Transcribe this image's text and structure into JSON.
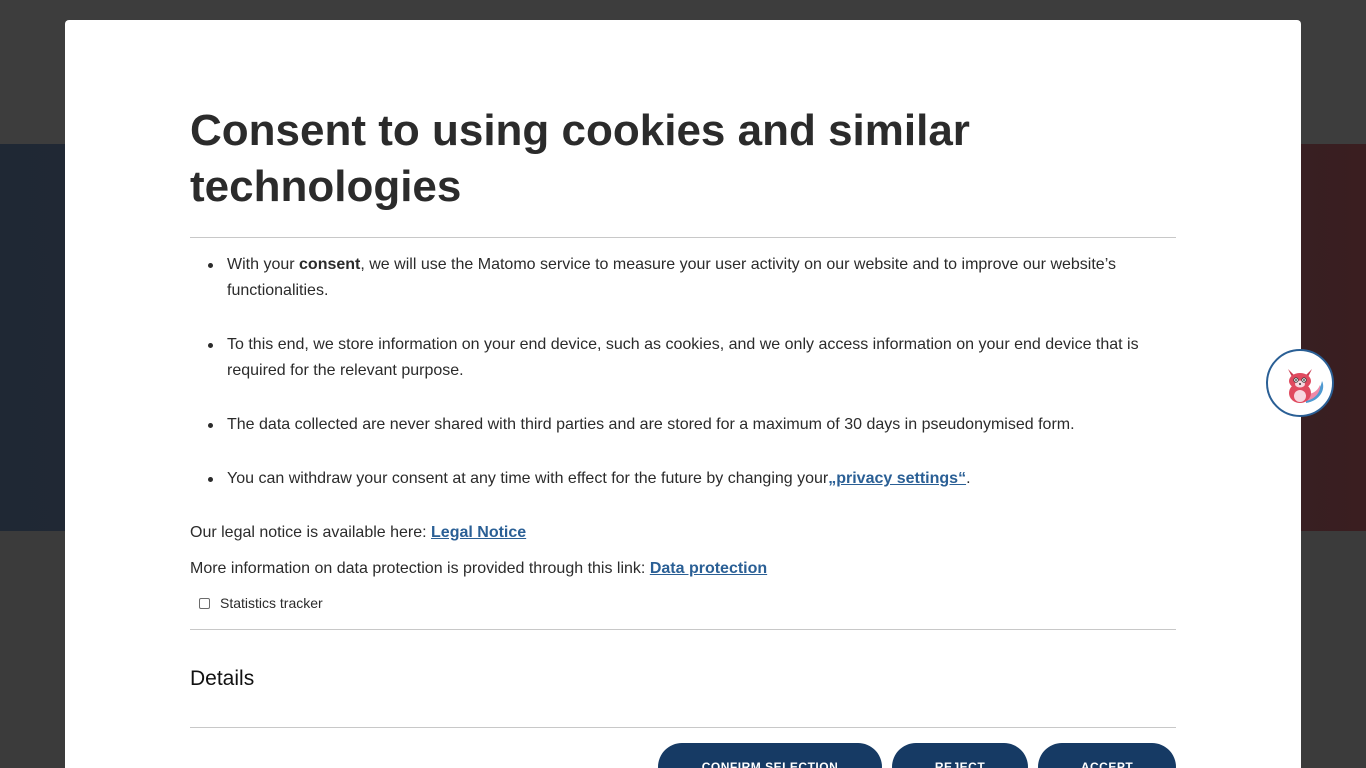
{
  "modal": {
    "title": "Consent to using cookies and similar technologies",
    "points": [
      {
        "pre": "With your ",
        "bold": "consent",
        "post": ", we will use the Matomo service to measure your user activity on our website and to improve our website’s functionalities."
      },
      {
        "text": "To this end, we store information on your end device, such as cookies, and we only access information on your end device that is required for the relevant purpose."
      },
      {
        "text": "The data collected are never shared with third parties and are stored for a maximum of 30 days in pseudonymised form."
      },
      {
        "pre": "You can withdraw your consent at any time with effect for the future by changing your",
        "link": "„privacy settings“",
        "post": "."
      }
    ],
    "legal_notice_text": "Our legal notice is available here: ",
    "legal_notice_link": "Legal Notice",
    "data_protection_text": "More information on data protection is provided through this link: ",
    "data_protection_link": "Data protection",
    "checkbox_label": "Statistics tracker",
    "details_label": "Details",
    "buttons": {
      "confirm": "CONFIRM SELECTION",
      "reject": "REJECT",
      "accept": "ACCEPT"
    }
  },
  "colors": {
    "button_bg": "#163a64",
    "link": "#2a5f95",
    "text": "#2b2b2b"
  },
  "widget": {
    "icon": "fox-assistant-icon"
  }
}
